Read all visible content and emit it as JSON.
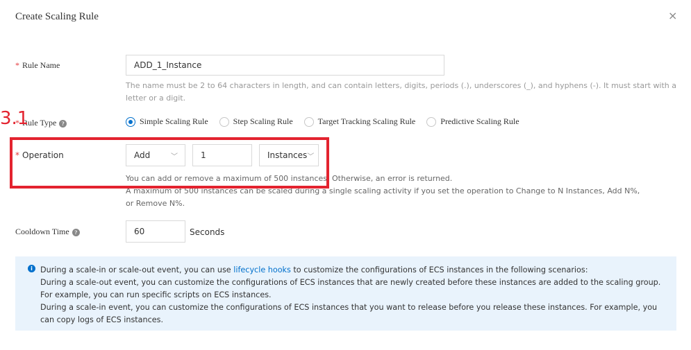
{
  "dialog": {
    "title": "Create Scaling Rule",
    "close_glyph": "×"
  },
  "rule_name": {
    "required_mark": "*",
    "label": "Rule Name",
    "value": "ADD_1_Instance",
    "help": "The name must be 2 to 64 characters in length, and can contain letters, digits, periods (.), underscores (_), and hyphens (-). It must start with a letter or a digit."
  },
  "rule_type": {
    "required_mark": "*",
    "label": "Rule Type",
    "options": [
      "Simple Scaling Rule",
      "Step Scaling Rule",
      "Target Tracking Scaling Rule",
      "Predictive Scaling Rule"
    ],
    "selected": "Simple Scaling Rule"
  },
  "operation": {
    "required_mark": "*",
    "label": "Operation",
    "action_value": "Add",
    "amount_value": "1",
    "unit_value": "Instances",
    "help_line1": "You can add or remove a maximum of 500 instances. Otherwise, an error is returned.",
    "help_line2": "A maximum of 500 instances can be scaled during a single scaling activity if you set the operation to Change to N Instances, Add N%,",
    "help_line3": "or Remove N%."
  },
  "cooldown": {
    "label": "Cooldown Time",
    "value": "60",
    "unit": "Seconds"
  },
  "info": {
    "line1_before": "During a scale-in or scale-out event, you can use ",
    "line1_link": "lifecycle hooks",
    "line1_after": " to customize the configurations of ECS instances in the following scenarios:",
    "line2": "During a scale-out event, you can customize the configurations of ECS instances that are newly created before these instances are added to the scaling group. For example, you can run specific scripts on ECS instances.",
    "line3": "During a scale-in event, you can customize the configurations of ECS instances that you want to release before you release these instances. For example, you can copy logs of ECS instances."
  },
  "annotation": {
    "step_number": "3.1",
    "color": "#e3232f"
  },
  "colors": {
    "accent": "#0070cc",
    "required": "#e4393c",
    "info_bg": "#e9f3fc"
  },
  "icons": {
    "close": "close-icon",
    "help": "question-circle-icon",
    "info": "info-circle-icon"
  }
}
